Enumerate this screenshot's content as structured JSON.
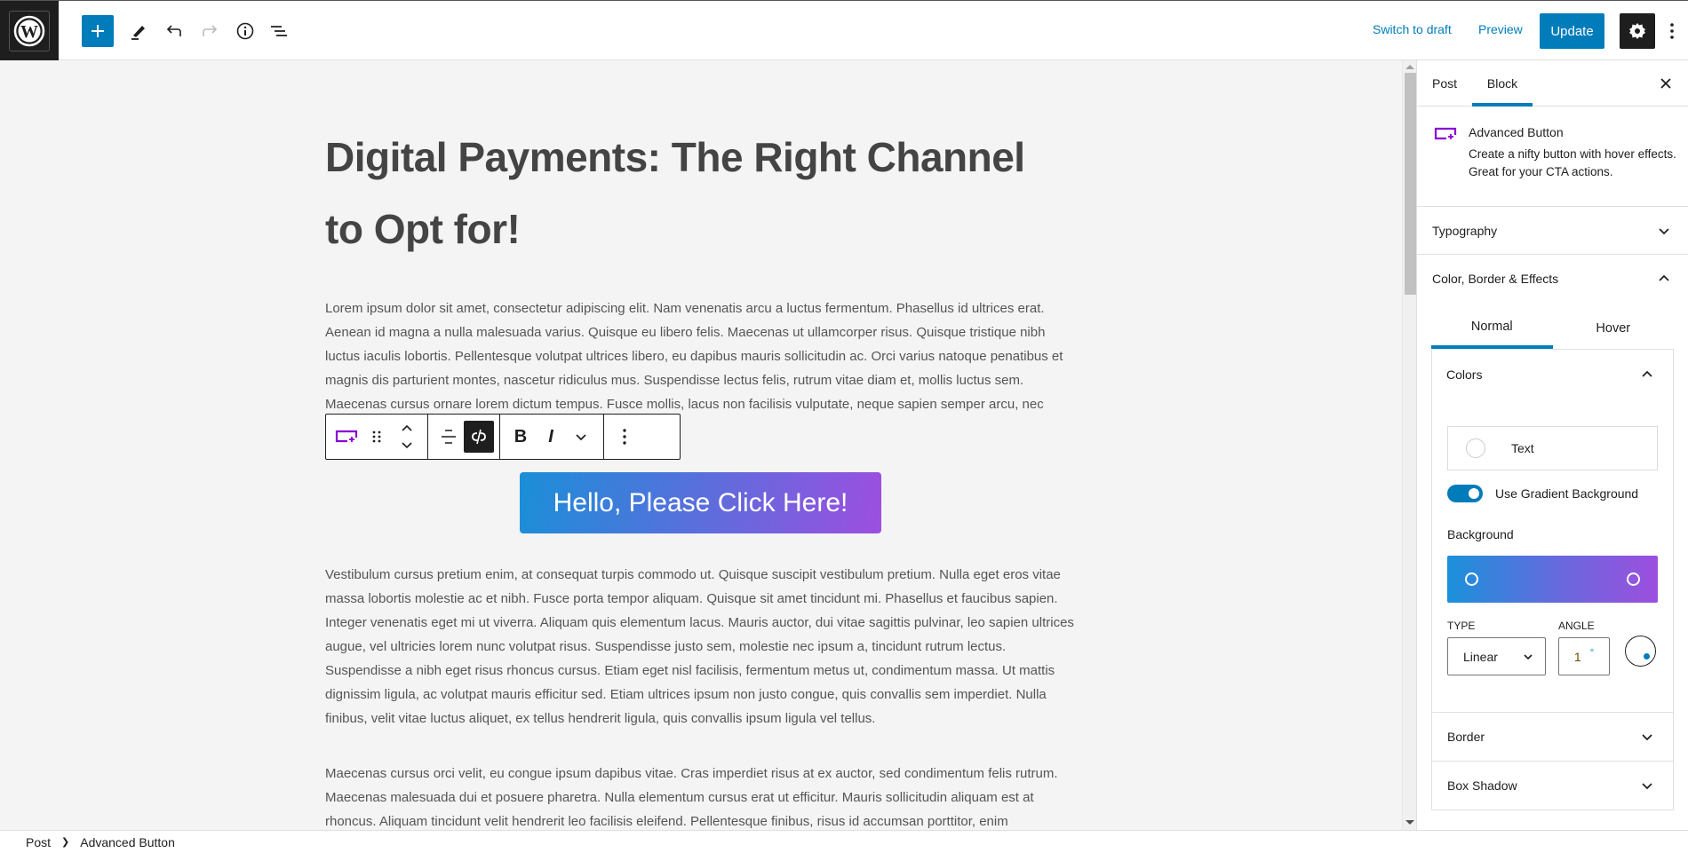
{
  "topbar": {
    "logo_icon": "wordpress-logo",
    "add_block_icon": "plus-icon",
    "tools_icon": "pencil-icon",
    "undo_icon": "undo-icon",
    "redo_icon": "redo-icon",
    "details_icon": "info-icon",
    "list_view_icon": "list-view-icon",
    "switch_to_draft": "Switch to draft",
    "preview": "Preview",
    "update": "Update",
    "settings_icon": "gear-icon",
    "more_icon": "more-vertical-icon"
  },
  "editor": {
    "title": "Digital Payments: The Right Channel to Opt for!",
    "paragraphs": [
      "Lorem ipsum dolor sit amet, consectetur adipiscing elit. Nam venenatis arcu a luctus fermentum. Phasellus id ultrices erat. Aenean id magna a nulla malesuada varius. Quisque eu libero felis. Maecenas ut ullamcorper risus. Quisque tristique nibh luctus iaculis lobortis. Pellentesque volutpat ultrices libero, eu dapibus mauris sollicitudin ac. Orci varius natoque penatibus et magnis dis parturient montes, nascetur ridiculus mus. Suspendisse lectus felis, rutrum vitae diam et, mollis luctus sem. Maecenas cursus ornare lorem dictum tempus. Fusce mollis, lacus non facilisis vulputate, neque sapien semper arcu, nec tincidunt lorem nisl nec nulla. Cras ut augue mi.",
      "Vestibulum cursus pretium enim, at consequat turpis commodo ut. Quisque suscipit vestibulum pretium. Nulla eget eros vitae massa lobortis molestie ac et nibh. Fusce porta tempor aliquam. Quisque sit amet tincidunt mi. Phasellus et faucibus sapien. Integer venenatis eget mi ut viverra. Aliquam quis elementum lacus. Mauris auctor, dui vitae sagittis pulvinar, leo sapien ultrices augue, vel ultricies lorem nunc volutpat risus. Suspendisse justo sem, molestie nec ipsum a, tincidunt rutrum lectus. Suspendisse a nibh eget risus rhoncus cursus. Etiam eget nisl facilisis, fermentum metus ut, condimentum massa. Ut mattis dignissim ligula, ac volutpat mauris efficitur sed. Etiam ultrices ipsum non justo congue, quis convallis sem imperdiet. Nulla finibus, velit vitae luctus aliquet, ex tellus hendrerit ligula, quis convallis ipsum ligula vel tellus.",
      "Maecenas cursus orci velit, eu congue ipsum dapibus vitae. Cras imperdiet risus at ex auctor, sed condimentum felis rutrum. Maecenas malesuada dui et posuere pharetra. Nulla elementum cursus erat ut efficitur. Mauris sollicitudin aliquam est at rhoncus. Aliquam tincidunt velit hendrerit leo facilisis eleifend. Pellentesque finibus, risus id accumsan porttitor, enim"
    ],
    "button_text": "Hello, Please Click Here!",
    "block_toolbar": {
      "block_type_icon": "advanced-button-icon",
      "drag_icon": "drag-handle-icon",
      "move_icon": "move-up-down-icon",
      "align_icon": "align-center-icon",
      "unlink_icon": "unlink-icon",
      "bold": "B",
      "italic": "I",
      "more_format_icon": "chevron-down-icon",
      "options_icon": "more-vertical-icon"
    }
  },
  "breadcrumb": {
    "items": [
      "Post",
      "Advanced Button"
    ]
  },
  "sidebar": {
    "tabs": [
      "Post",
      "Block"
    ],
    "active_tab": "Block",
    "block_card": {
      "title": "Advanced Button",
      "description": "Create a nifty button with hover effects. Great for your CTA actions."
    },
    "panels": {
      "typography": "Typography",
      "color_border_effects": "Color, Border & Effects"
    },
    "state_tabs": [
      "Normal",
      "Hover"
    ],
    "active_state_tab": "Normal",
    "colors": {
      "title": "Colors",
      "text_label": "Text",
      "gradient_toggle_label": "Use Gradient Background",
      "gradient_enabled": true,
      "background_label": "Background",
      "gradient_start": "#1a91db",
      "gradient_end": "#9d4fdf",
      "type_label": "TYPE",
      "type_value": "Linear",
      "angle_label": "ANGLE",
      "angle_value": "1",
      "angle_unit": "°"
    },
    "sub_panels": [
      "Border",
      "Box Shadow"
    ]
  },
  "colors": {
    "accent": "#007cba",
    "dark": "#1e1e1e",
    "block_icon": "#8a00d4"
  }
}
